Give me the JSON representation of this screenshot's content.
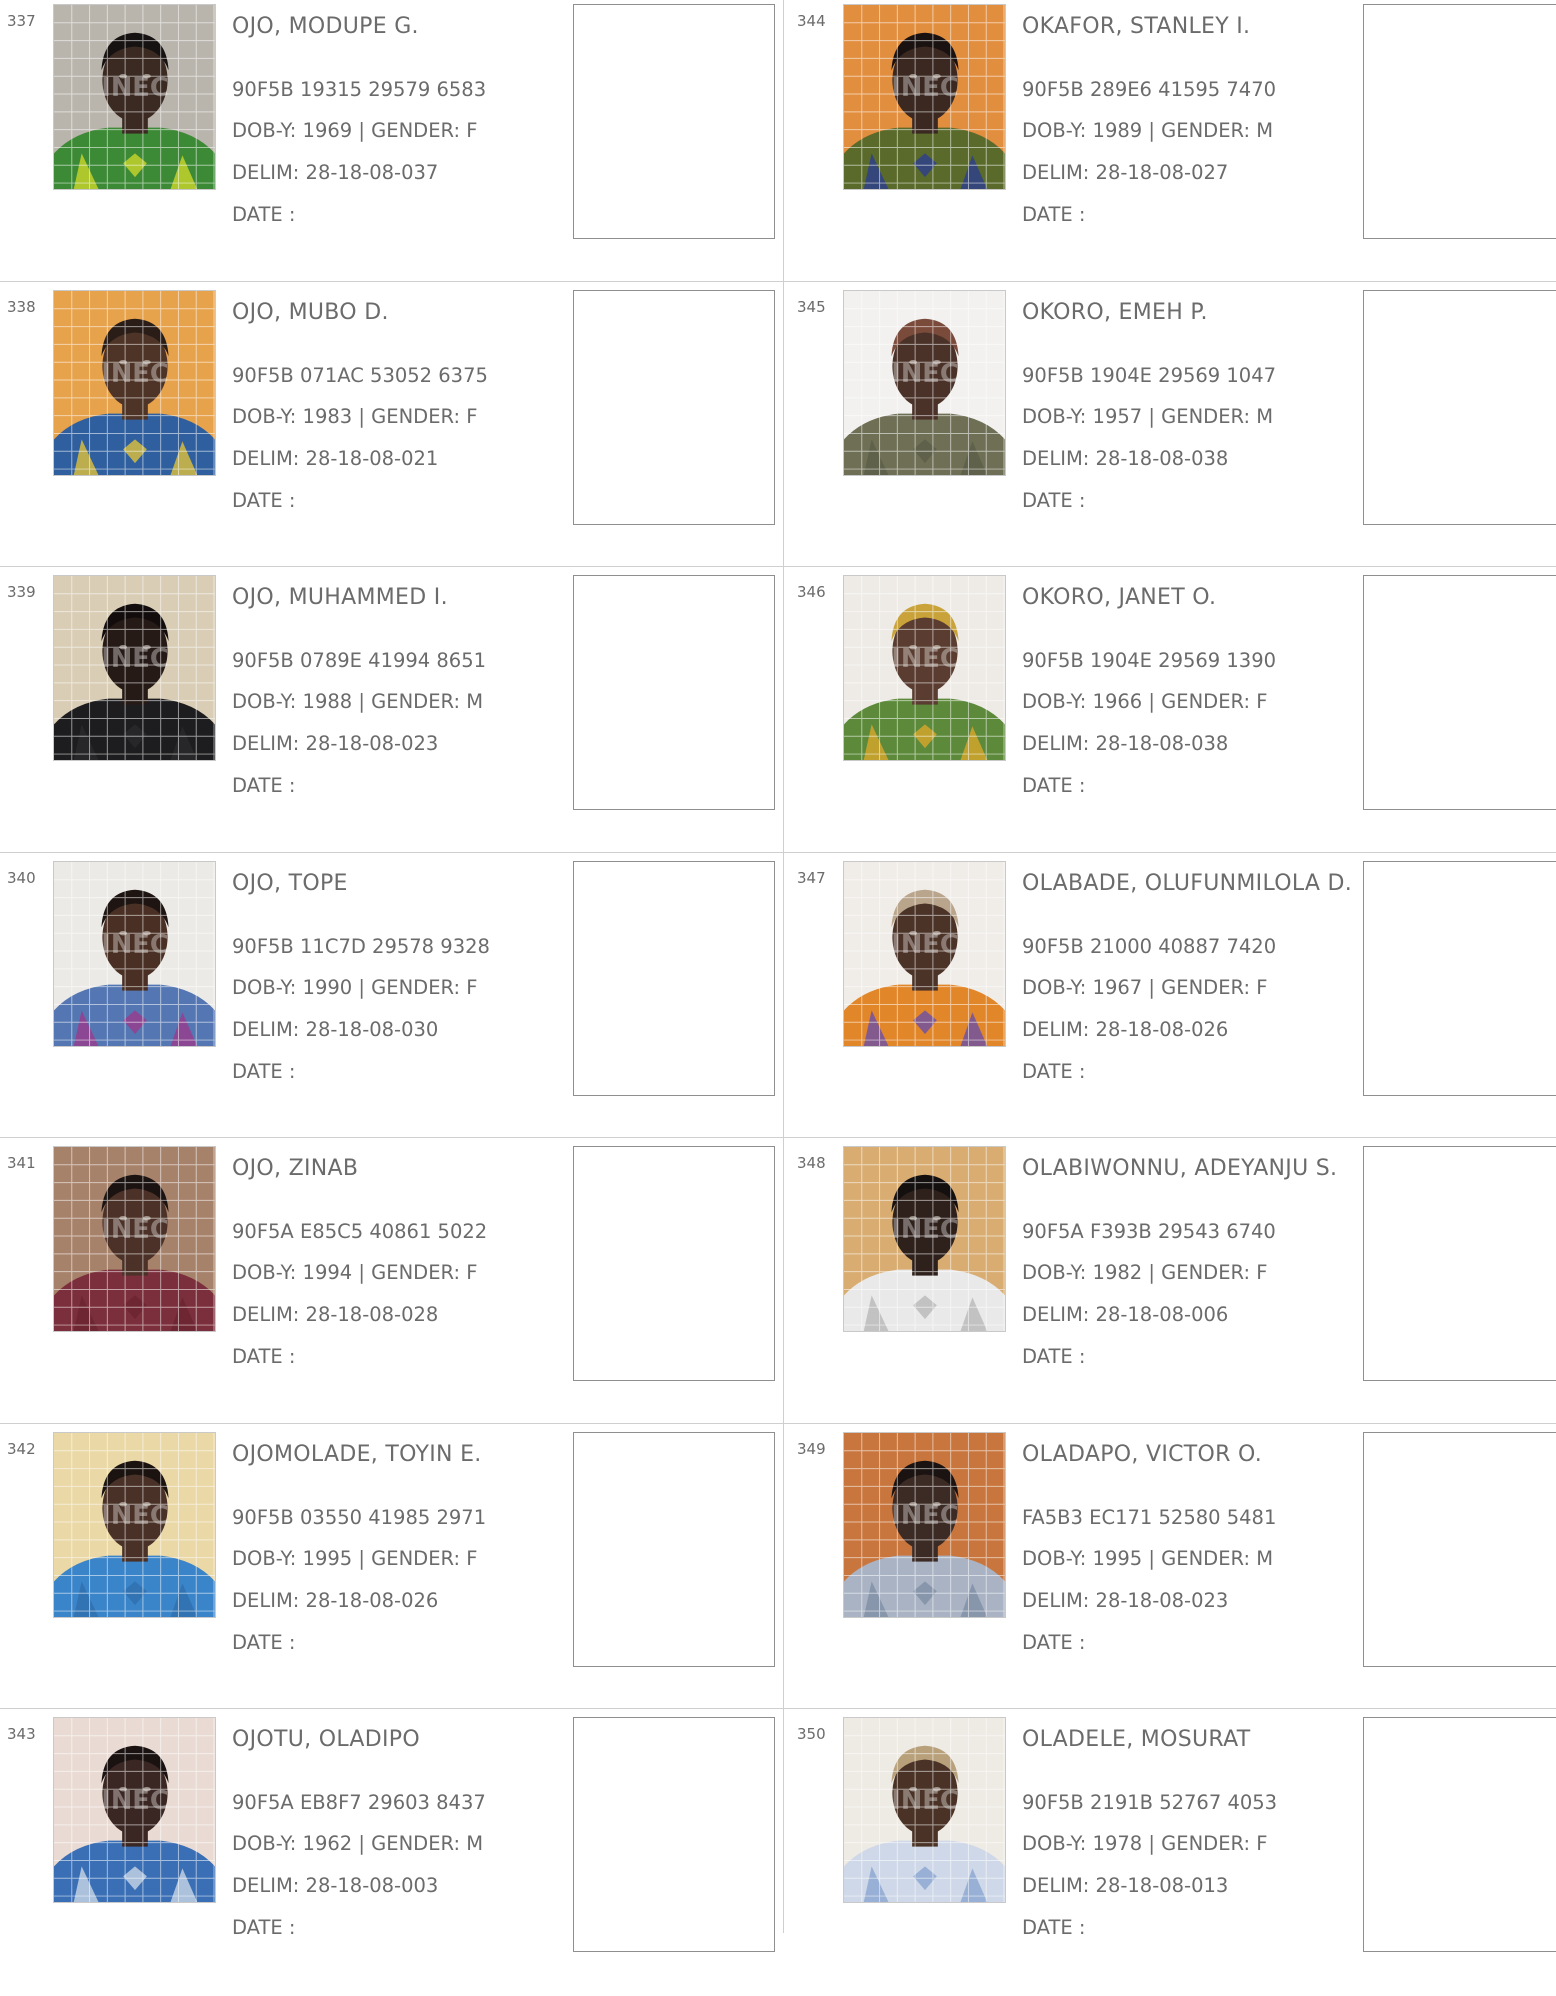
{
  "colors": {
    "text": "#6b6b6b",
    "divider": "#cfcfcf",
    "box_border": "#8f8f8f"
  },
  "watermark_text": "INEC",
  "voters": [
    {
      "serial": "337",
      "name": "OJO, MODUPE G.",
      "vin": "90F5B 19315 29579 6583",
      "dob": "DOB-Y: 1969",
      "gender": "| GENDER: F",
      "delim": "DELIM: 28-18-08-037",
      "date": "DATE  :",
      "photo": {
        "bg": "#b9b4ac",
        "skin": "#3b2a22",
        "hair": "#161212",
        "cloth": "#3d8a36",
        "cloth2": "#c9d62b"
      }
    },
    {
      "serial": "338",
      "name": "OJO, MUBO D.",
      "vin": "90F5B 071AC 53052 6375",
      "dob": "DOB-Y: 1983",
      "gender": "| GENDER: F",
      "delim": "DELIM: 28-18-08-021",
      "date": "DATE  :",
      "photo": {
        "bg": "#e7a24c",
        "skin": "#4e3426",
        "hair": "#2a1d18",
        "cloth": "#2f5f9e",
        "cloth2": "#e0c23a"
      }
    },
    {
      "serial": "339",
      "name": "OJO, MUHAMMED I.",
      "vin": "90F5B 0789E 41994 8651",
      "dob": "DOB-Y: 1988",
      "gender": "| GENDER: M",
      "delim": "DELIM: 28-18-08-023",
      "date": "DATE  :",
      "photo": {
        "bg": "#d9cdb5",
        "skin": "#261a16",
        "hair": "#120d0c",
        "cloth": "#1d1d1f",
        "cloth2": "#2a2a2c"
      }
    },
    {
      "serial": "340",
      "name": "OJO, TOPE",
      "vin": "90F5B 11C7D 29578 9328",
      "dob": "DOB-Y: 1990",
      "gender": "| GENDER: F",
      "delim": "DELIM: 28-18-08-030",
      "date": "DATE  :",
      "photo": {
        "bg": "#eceae6",
        "skin": "#4a3024",
        "hair": "#1e1512",
        "cloth": "#5477b3",
        "cloth2": "#9a3b8c"
      }
    },
    {
      "serial": "341",
      "name": "OJO, ZINAB",
      "vin": "90F5A E85C5 40861 5022",
      "dob": "DOB-Y: 1994",
      "gender": "| GENDER: F",
      "delim": "DELIM: 28-18-08-028",
      "date": "DATE  :",
      "photo": {
        "bg": "#a7826b",
        "skin": "#4b3127",
        "hair": "#1b1311",
        "cloth": "#7b2e3b",
        "cloth2": "#6b2431"
      }
    },
    {
      "serial": "342",
      "name": "OJOMOLADE, TOYIN E.",
      "vin": "90F5B 03550 41985 2971",
      "dob": "DOB-Y: 1995",
      "gender": "| GENDER: F",
      "delim": "DELIM: 28-18-08-026",
      "date": "DATE  :",
      "photo": {
        "bg": "#ead8a6",
        "skin": "#4a3127",
        "hair": "#1a1310",
        "cloth": "#3a84c9",
        "cloth2": "#2f6fae"
      }
    },
    {
      "serial": "343",
      "name": "OJOTU, OLADIPO",
      "vin": "90F5A EB8F7 29603 8437",
      "dob": "DOB-Y: 1962",
      "gender": "| GENDER: M",
      "delim": "DELIM: 28-18-08-003",
      "date": "DATE  :",
      "photo": {
        "bg": "#e9dbd3",
        "skin": "#3a2622",
        "hair": "#1a1211",
        "cloth": "#3a6fb6",
        "cloth2": "#c8d6e6"
      }
    },
    {
      "serial": "344",
      "name": "OKAFOR, STANLEY I.",
      "vin": "90F5B 289E6 41595 7470",
      "dob": "DOB-Y: 1989",
      "gender": "| GENDER: M",
      "delim": "DELIM: 28-18-08-027",
      "date": "DATE  :",
      "photo": {
        "bg": "#e28e3f",
        "skin": "#3a2821",
        "hair": "#1a1210",
        "cloth": "#5a6a2a",
        "cloth2": "#2b3d8f"
      }
    },
    {
      "serial": "345",
      "name": "OKORO, EMEH P.",
      "vin": "90F5B 1904E 29569 1047",
      "dob": "DOB-Y: 1957",
      "gender": "| GENDER: M",
      "delim": "DELIM: 28-18-08-038",
      "date": "DATE  :",
      "photo": {
        "bg": "#f2f1ef",
        "skin": "#4b3229",
        "hair": "#7a4a3a",
        "cloth": "#6e6f55",
        "cloth2": "#5d5e47"
      }
    },
    {
      "serial": "346",
      "name": "OKORO, JANET O.",
      "vin": "90F5B 1904E 29569 1390",
      "dob": "DOB-Y: 1966",
      "gender": "| GENDER: F",
      "delim": "DELIM: 28-18-08-038",
      "date": "DATE  :",
      "photo": {
        "bg": "#eeebe6",
        "skin": "#5a3d30",
        "hair": "#c9a33a",
        "cloth": "#5c8a3a",
        "cloth2": "#d9a62c"
      }
    },
    {
      "serial": "347",
      "name": "OLABADE, OLUFUNMILOLA D.",
      "vin": "90F5B 21000 40887 7420",
      "dob": "DOB-Y: 1967",
      "gender": "| GENDER: F",
      "delim": "DELIM: 28-18-08-026",
      "date": "DATE  :",
      "photo": {
        "bg": "#f0ede8",
        "skin": "#4c3328",
        "hair": "#b9a58c",
        "cloth": "#e2862a",
        "cloth2": "#6a4fa6"
      }
    },
    {
      "serial": "348",
      "name": "OLABIWONNU, ADEYANJU S.",
      "vin": "90F5A F393B 29543 6740",
      "dob": "DOB-Y: 1982",
      "gender": "| GENDER: F",
      "delim": "DELIM: 28-18-08-006",
      "date": "DATE  :",
      "photo": {
        "bg": "#d9ad72",
        "skin": "#2e201b",
        "hair": "#151010",
        "cloth": "#e9e9e9",
        "cloth2": "#b8b8b8"
      }
    },
    {
      "serial": "349",
      "name": "OLADAPO, VICTOR O.",
      "vin": "FA5B3 EC171 52580 5481",
      "dob": "DOB-Y: 1995",
      "gender": "| GENDER: M",
      "delim": "DELIM: 28-18-08-023",
      "date": "DATE  :",
      "photo": {
        "bg": "#c9763e",
        "skin": "#3c2a24",
        "hair": "#1b1311",
        "cloth": "#a9b3c4",
        "cloth2": "#7f8fa6"
      }
    },
    {
      "serial": "350",
      "name": "OLADELE, MOSURAT",
      "vin": "90F5B 2191B 52767 4053",
      "dob": "DOB-Y: 1978",
      "gender": "| GENDER: F",
      "delim": "DELIM: 28-18-08-013",
      "date": "DATE  :",
      "photo": {
        "bg": "#eeeae4",
        "skin": "#4a3326",
        "hair": "#b8a07a",
        "cloth": "#cfd8e8",
        "cloth2": "#8aa6d0"
      }
    }
  ]
}
